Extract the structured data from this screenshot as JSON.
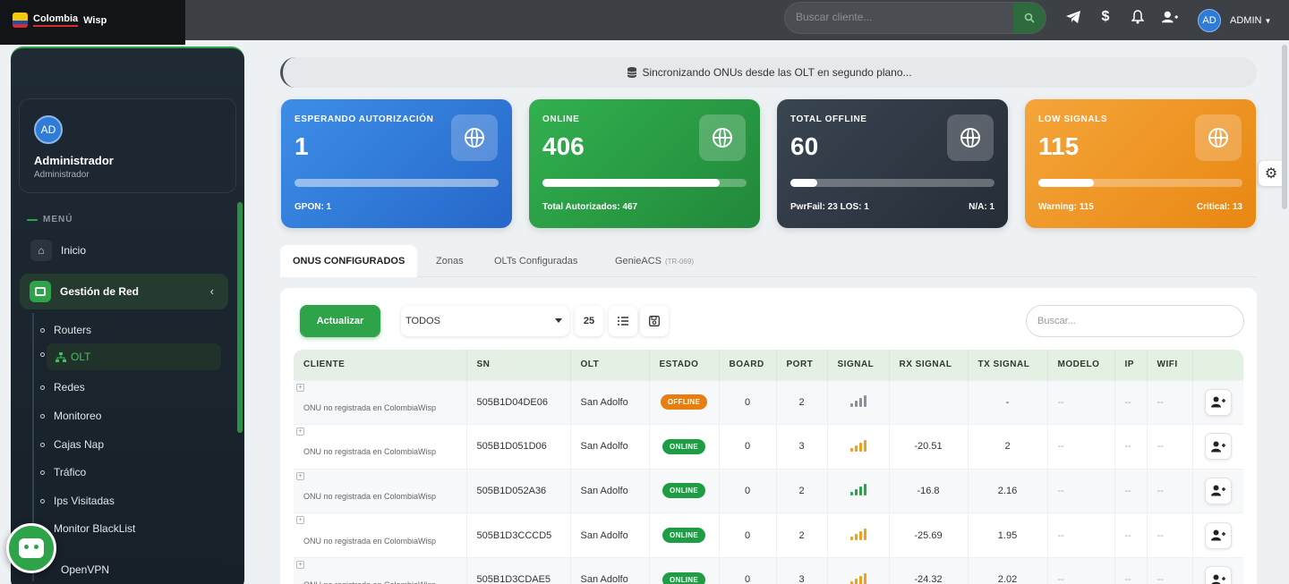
{
  "header": {
    "brand": "Colombia",
    "brand_suffix": "Wisp",
    "search_placeholder": "Buscar cliente...",
    "user_initials": "AD",
    "user_label": "ADMIN"
  },
  "sidebar": {
    "profile": {
      "initials": "AD",
      "name": "Administrador",
      "role": "Administrador"
    },
    "menu_title": "MENÚ",
    "inicio": "Inicio",
    "group": "Gestión de Red",
    "sub_items": [
      "Routers",
      "OLT",
      "Redes",
      "Monitoreo",
      "Cajas Nap",
      "Tráfico",
      "Ips Visitadas",
      "Monitor BlackList"
    ],
    "openvpn": "OpenVPN"
  },
  "sync_message": "Sincronizando ONUs desde las OLT en segundo plano...",
  "stats": [
    {
      "title": "ESPERANDO AUTORIZACIÓN",
      "value": "1",
      "progress": 1.0,
      "foot_left": "GPON: 1",
      "foot_right": ""
    },
    {
      "title": "ONLINE",
      "value": "406",
      "progress": 0.87,
      "foot_left": "Total Autorizados: 467",
      "foot_right": ""
    },
    {
      "title": "TOTAL OFFLINE",
      "value": "60",
      "progress": 0.13,
      "foot_left": "PwrFail: 23 LOS: 1",
      "foot_right": "N/A: 1"
    },
    {
      "title": "LOW SIGNALS",
      "value": "115",
      "progress": 0.27,
      "foot_left": "Warning: 115",
      "foot_right": "Critical: 13"
    }
  ],
  "tabs": [
    {
      "label": "ONUS CONFIGURADOS",
      "sub": ""
    },
    {
      "label": "Zonas",
      "sub": ""
    },
    {
      "label": "OLTs Configuradas",
      "sub": ""
    },
    {
      "label": "GenieACS",
      "sub": "(TR-069)"
    }
  ],
  "toolbar": {
    "update_label": "Actualizar",
    "filter_value": "TODOS",
    "page_size": "25",
    "search_placeholder": "Buscar..."
  },
  "table": {
    "columns": [
      "CLIENTE",
      "SN",
      "OLT",
      "ESTADO",
      "BOARD",
      "PORT",
      "SIGNAL",
      "RX SIGNAL",
      "TX SIGNAL",
      "MODELO",
      "IP",
      "WIFI",
      ""
    ],
    "rows": [
      {
        "cliente": "ONU no registrada en ColombiaWisp",
        "sn": "505B1D04DE06",
        "olt": "San Adolfo",
        "estado": "OFFLINE",
        "board": "0",
        "port": "2",
        "signal": "gray",
        "rx": "",
        "tx": "-",
        "modelo": "--",
        "ip": "--",
        "wifi": "--"
      },
      {
        "cliente": "ONU no registrada en ColombiaWisp",
        "sn": "505B1D051D06",
        "olt": "San Adolfo",
        "estado": "ONLINE",
        "board": "0",
        "port": "3",
        "signal": "orange",
        "rx": "-20.51",
        "tx": "2",
        "modelo": "--",
        "ip": "--",
        "wifi": "--"
      },
      {
        "cliente": "ONU no registrada en ColombiaWisp",
        "sn": "505B1D052A36",
        "olt": "San Adolfo",
        "estado": "ONLINE",
        "board": "0",
        "port": "2",
        "signal": "green",
        "rx": "-16.8",
        "tx": "2.16",
        "modelo": "--",
        "ip": "--",
        "wifi": "--"
      },
      {
        "cliente": "ONU no registrada en ColombiaWisp",
        "sn": "505B1D3CCCD5",
        "olt": "San Adolfo",
        "estado": "ONLINE",
        "board": "0",
        "port": "2",
        "signal": "orange",
        "rx": "-25.69",
        "tx": "1.95",
        "modelo": "--",
        "ip": "--",
        "wifi": "--"
      },
      {
        "cliente": "ONU no registrada en ColombiaWisp",
        "sn": "505B1D3CDAE5",
        "olt": "San Adolfo",
        "estado": "ONLINE",
        "board": "0",
        "port": "3",
        "signal": "orange",
        "rx": "-24.32",
        "tx": "2.02",
        "modelo": "--",
        "ip": "--",
        "wifi": "--"
      }
    ]
  },
  "colors": {
    "accent": "#2ea34a",
    "offline": "#e67e12",
    "signal_orange": "#f0a020",
    "signal_green": "#2ea34a",
    "signal_gray": "#8a9099"
  }
}
